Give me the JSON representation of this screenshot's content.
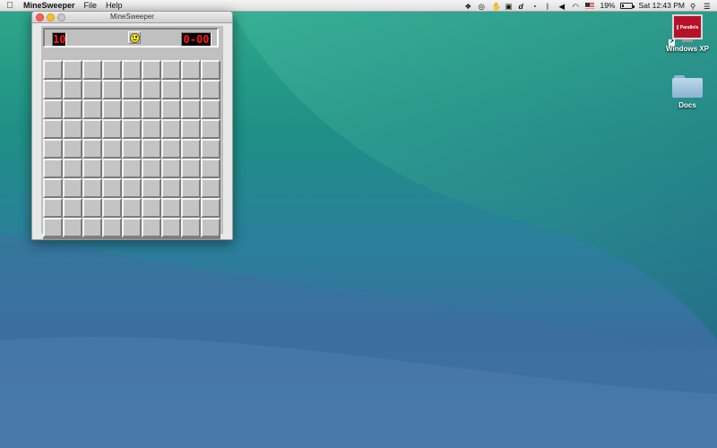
{
  "menubar": {
    "app_name": "MineSweeper",
    "menus": [
      "File",
      "Help"
    ],
    "battery_percent": "19%",
    "clock": "Sat 12:43 PM",
    "status_icons": [
      "dropbox-icon",
      "sync-icon",
      "hand-icon",
      "box-icon",
      "d-icon",
      "timer-icon",
      "bluetooth-icon",
      "volume-icon",
      "wifi-icon",
      "us-flag-icon",
      "battery-icon",
      "search-icon",
      "list-icon"
    ]
  },
  "window": {
    "title": "MineSweeper",
    "mine_counter": "10",
    "timer": "0-00",
    "grid": {
      "rows": 9,
      "cols": 9,
      "state": "all-covered"
    }
  },
  "desktop_icons": [
    {
      "label": "Windows XP",
      "brand": "|| Parallels",
      "icon": "parallels-vm-icon"
    },
    {
      "label": "Docs",
      "icon": "folder-icon"
    }
  ],
  "colors": {
    "led_red": "#ff1a1a",
    "brand_red": "#b5122a"
  }
}
